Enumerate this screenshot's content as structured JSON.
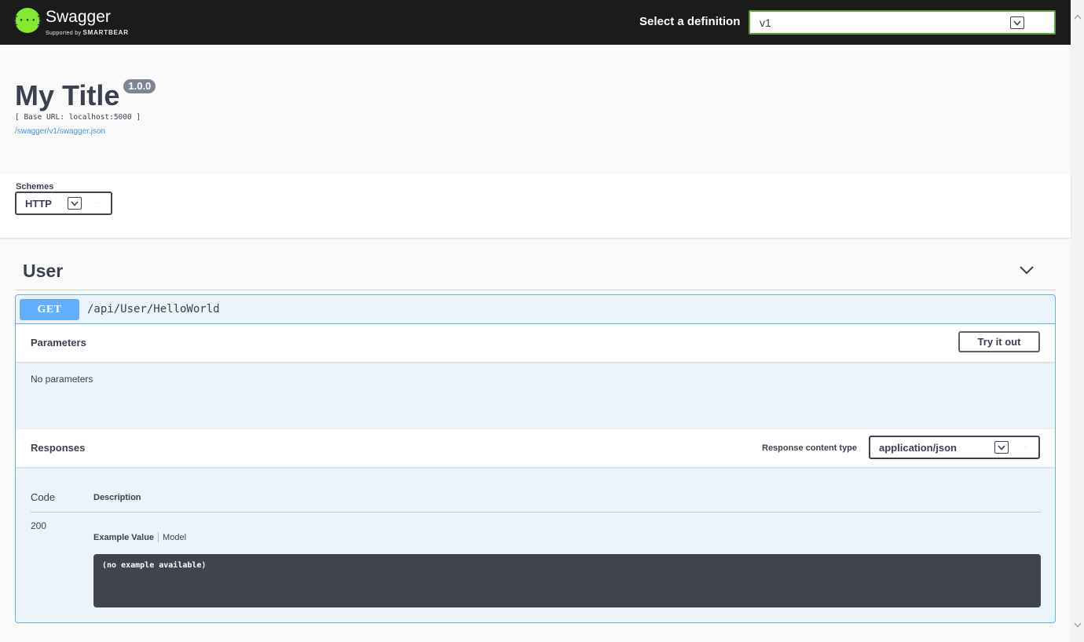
{
  "topbar": {
    "logo_word": "Swagger",
    "logo_sub_prefix": "Supported by",
    "logo_sub_brand": "SMARTBEAR",
    "definition_label": "Select a definition",
    "definition_value": "v1"
  },
  "info": {
    "title": "My Title",
    "version": "1.0.0",
    "base_url": "[ Base URL: localhost:5000 ]",
    "spec_link": "/swagger/v1/swagger.json"
  },
  "schemes": {
    "label": "Schemes",
    "value": "HTTP"
  },
  "tag": {
    "name": "User"
  },
  "operation": {
    "method": "GET",
    "path": "/api/User/HelloWorld",
    "parameters_title": "Parameters",
    "try_button": "Try it out",
    "no_parameters": "No parameters",
    "responses_title": "Responses",
    "response_content_type_label": "Response content type",
    "response_content_type_value": "application/json",
    "columns": {
      "code": "Code",
      "description": "Description"
    },
    "responses": [
      {
        "code": "200",
        "tabs": [
          "Example Value",
          "Model"
        ],
        "example": "(no example available)"
      }
    ]
  },
  "colors": {
    "topbar_bg": "#1b1b1b",
    "logo_green": "#85ea2d",
    "get_blue": "#61affe",
    "op_bg": "#ebf3fb",
    "example_bg": "#41444e",
    "link_blue": "#4990e2"
  },
  "icons": {
    "logo": "swagger-logo-icon",
    "dropdown": "dropdown-arrow-icon",
    "collapse": "chevron-down-icon"
  }
}
